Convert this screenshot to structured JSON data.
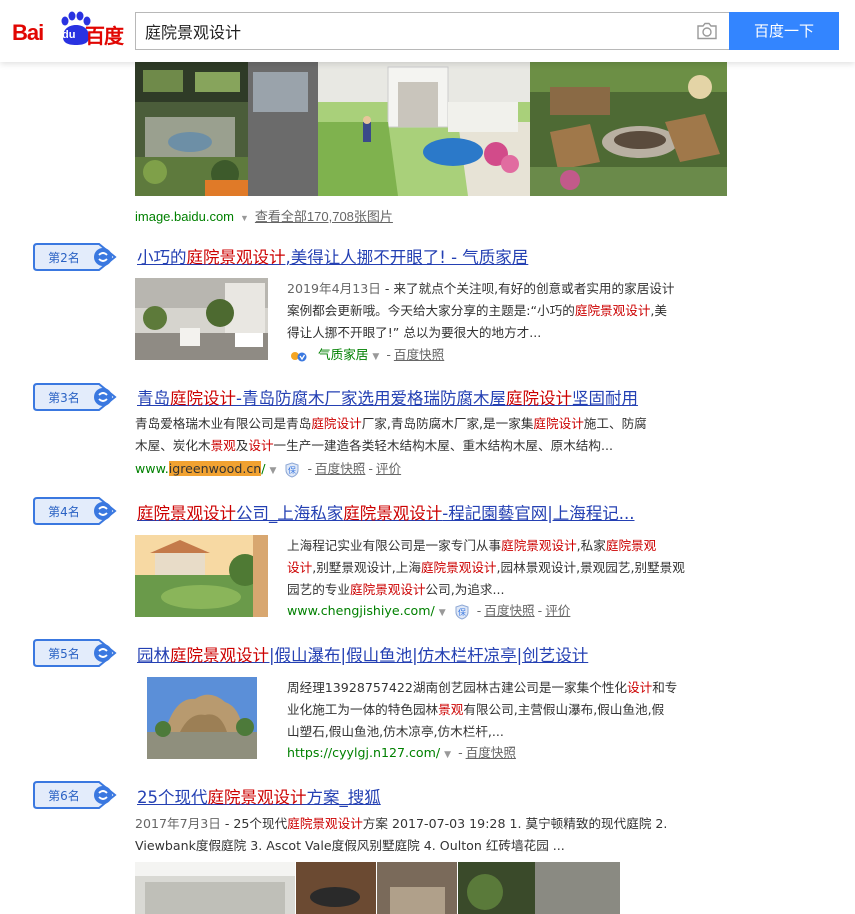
{
  "header": {
    "logo_bai": "Bai",
    "logo_du": "du",
    "logo_cn": "百度",
    "search_value": "庭院景观设计",
    "search_button": "百度一下"
  },
  "image_block": {
    "source": "image.baidu.com",
    "see_all": "查看全部170,708张图片"
  },
  "results": [
    {
      "rank": "第2名",
      "title_parts": [
        "小巧的",
        "庭院景观设计",
        ",美得让人挪不开眼了! - 气质家居"
      ],
      "abstract_date": "2019年4月13日",
      "abstract_line1": " - 来了就点个关注呗,有好的创意或者实用的家居设计",
      "abstract_line2": "案例都会更新哦。今天给大家分享的主题是:“小巧的",
      "abstract_hl": "庭院景观设计",
      "abstract_line2b": ",美",
      "abstract_line3": "得让人挪不开眼了!” 总以为要很大的地方才...",
      "source_name": "气质家居",
      "cache": "百度快照"
    },
    {
      "rank": "第3名",
      "title_a": "青岛",
      "title_b": "庭院设计",
      "title_c": "-青岛防腐木厂家选用爱格瑞防腐木屋",
      "title_d": "庭院设计",
      "title_e": "坚固耐用",
      "l1a": "青岛爱格瑞木业有限公司是青岛",
      "l1b": "庭院设计",
      "l1c": "厂家,青岛防腐木厂家,是一家集",
      "l1d": "庭院设计",
      "l1e": "施工、防腐",
      "l2a": "木屋、炭化木",
      "l2b": "景观",
      "l2c": "及",
      "l2d": "设计",
      "l2e": "一生产一建造各类轻木结构木屋、重木结构木屋、原木结构...",
      "url_a": "www.",
      "url_b": "igreenwood.cn",
      "url_c": "/",
      "cache": "百度快照",
      "review": "评价"
    },
    {
      "rank": "第4名",
      "t1": "庭院景观设计",
      "t2": "公司_上海私家",
      "t3": "庭院景观设计",
      "t4": "-程記園藝官网|上海程记...",
      "l1a": "上海程记实业有限公司是一家专门从事",
      "l1b": "庭院景观设计",
      "l1c": ",私家",
      "l1d": "庭院景观",
      "l2a": "设计",
      "l2b": ",别墅景观设计,上海",
      "l2c": "庭院景观设计",
      "l2d": ",园林景观设计,景观园艺,别墅景观",
      "l3a": "园艺的专业",
      "l3b": "庭院景观设计",
      "l3c": "公司,为追求...",
      "url": "www.chengjishiye.com/",
      "cache": "百度快照",
      "review": "评价"
    },
    {
      "rank": "第5名",
      "t1": "园林",
      "t2": "庭院景观设计",
      "t3": "|假山瀑布|假山鱼池|仿木栏杆凉亭|创艺设计",
      "l1a": "周经理13928757422湖南创艺园林古建公司是一家集个性化",
      "l1b": "设计",
      "l1c": "和专",
      "l2a": "业化施工为一体的特色园林",
      "l2b": "景观",
      "l2c": "有限公司,主营假山瀑布,假山鱼池,假",
      "l3": "山塑石,假山鱼池,仿木凉亭,仿木栏杆,...",
      "url": "https://cyylgj.n127.com/",
      "cache": "百度快照"
    },
    {
      "rank": "第6名",
      "t1": "25个现代",
      "t2": "庭院景观设计",
      "t3": "方案_搜狐",
      "l1a": "2017年7月3日",
      "l1b": " - 25个现代",
      "l1c": "庭院景观设计",
      "l1d": "方案 2017-07-03 19:28 1. 莫宁顿精致的现代庭院 2.",
      "l2": "Viewbank度假庭院 3. Ascot Vale度假风别墅庭院 4. Oulton 红砖墙花园 ..."
    }
  ],
  "colors": {
    "link": "#2440b3",
    "highlight": "#c00000",
    "url": "#008000",
    "button": "#3385ff",
    "badge": "#3a78e0"
  }
}
